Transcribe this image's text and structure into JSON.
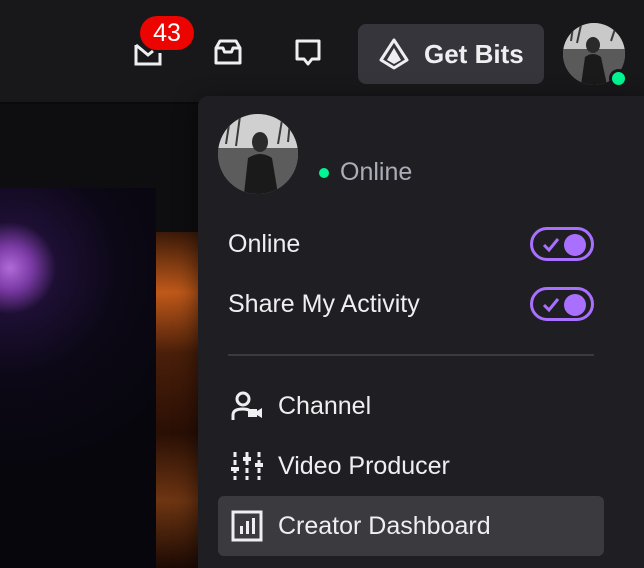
{
  "header": {
    "notifications": {
      "count": "43",
      "icon": "notifications-icon"
    },
    "inbox_icon": "inbox-icon",
    "whispers_icon": "whispers-icon",
    "get_bits_label": "Get Bits",
    "bits_icon": "bits-icon",
    "avatar_status_color": "#00f593"
  },
  "menu": {
    "status_label": "Online",
    "toggles": [
      {
        "label": "Online",
        "enabled": true
      },
      {
        "label": "Share My Activity",
        "enabled": true
      }
    ],
    "items": [
      {
        "label": "Channel",
        "icon": "channel-icon",
        "active": false
      },
      {
        "label": "Video Producer",
        "icon": "video-producer-icon",
        "active": false
      },
      {
        "label": "Creator Dashboard",
        "icon": "creator-dashboard-icon",
        "active": true
      }
    ]
  },
  "colors": {
    "accent": "#a970ff",
    "online": "#00f593",
    "badge": "#eb0400",
    "menu_bg": "#1f1f23",
    "topbar_bg": "#18181b"
  }
}
